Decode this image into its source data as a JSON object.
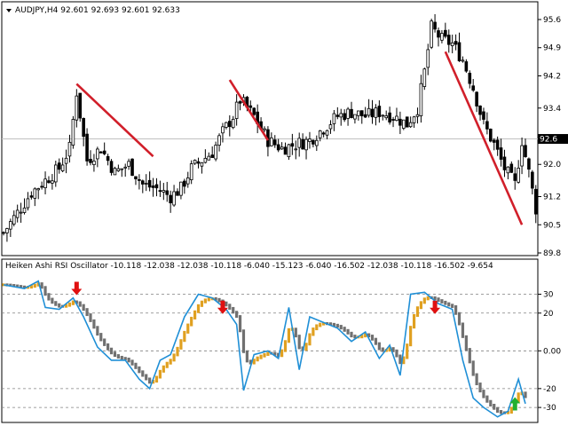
{
  "main_panel": {
    "title": "AUDJPY,H4  92.601 92.693 92.601 92.633",
    "price_labels": [
      "95.6",
      "94.9",
      "94.2",
      "93.4",
      "92.6",
      "92.0",
      "91.2",
      "90.5",
      "89.8"
    ],
    "current_price_label": "92.6",
    "current_price": 92.633,
    "colors": {
      "bull": "#000000",
      "bear": "#000000",
      "trendline": "#d11f2a",
      "current_line": "#c0c0c0"
    }
  },
  "indicator_panel": {
    "title": "Heiken Ashi RSI Oscillator -10.118 -12.038 -12.038 -10.118 -6.040 -15.123 -6.040 -16.502 -12.038 -10.118 -16.502 -9.654",
    "level_labels": [
      "30",
      "20",
      "0.00",
      "-20",
      "-30"
    ],
    "colors": {
      "rsi_line": "#1f8fd6",
      "bull_bar": "#e0a020",
      "bear_bar": "#707070",
      "sell_arrow": "#e01010",
      "buy_arrow": "#20b030",
      "level_line": "#808080"
    }
  },
  "chart_data": [
    {
      "type": "candlestick",
      "title": "AUDJPY,H4  92.601 92.693 92.601 92.633",
      "ylim": [
        89.8,
        95.6
      ],
      "y_ticks": [
        95.6,
        94.9,
        94.2,
        93.4,
        92.6,
        92.0,
        91.2,
        90.5,
        89.8
      ],
      "close_path": [
        [
          0,
          90.3
        ],
        [
          4,
          90.8
        ],
        [
          8,
          91.3
        ],
        [
          12,
          91.6
        ],
        [
          16,
          91.9
        ],
        [
          19,
          92.4
        ],
        [
          21,
          93.8
        ],
        [
          24,
          92.1
        ],
        [
          28,
          92.4
        ],
        [
          32,
          91.8
        ],
        [
          36,
          92.0
        ],
        [
          40,
          91.5
        ],
        [
          44,
          91.4
        ],
        [
          48,
          91.2
        ],
        [
          51,
          91.4
        ],
        [
          54,
          91.9
        ],
        [
          57,
          92.1
        ],
        [
          60,
          92.3
        ],
        [
          63,
          92.8
        ],
        [
          66,
          93.2
        ],
        [
          68,
          93.6
        ],
        [
          72,
          93.2
        ],
        [
          76,
          92.6
        ],
        [
          80,
          92.4
        ],
        [
          84,
          92.5
        ],
        [
          88,
          92.6
        ],
        [
          92,
          92.9
        ],
        [
          96,
          93.2
        ],
        [
          100,
          93.3
        ],
        [
          104,
          93.2
        ],
        [
          108,
          93.3
        ],
        [
          112,
          93.2
        ],
        [
          116,
          93.0
        ],
        [
          119,
          93.4
        ],
        [
          121,
          94.3
        ],
        [
          123,
          95.4
        ],
        [
          126,
          95.1
        ],
        [
          129,
          95.0
        ],
        [
          132,
          94.6
        ],
        [
          135,
          93.9
        ],
        [
          138,
          93.0
        ],
        [
          141,
          92.5
        ],
        [
          144,
          91.9
        ],
        [
          147,
          91.5
        ],
        [
          149,
          92.6
        ],
        [
          151,
          91.8
        ],
        [
          153,
          90.9
        ]
      ],
      "trendlines": [
        {
          "from": [
            21,
            94.0
          ],
          "to": [
            43,
            92.2
          ]
        },
        {
          "from": [
            65,
            94.1
          ],
          "to": [
            76,
            92.6
          ]
        },
        {
          "from": [
            127,
            94.8
          ],
          "to": [
            149,
            90.5
          ]
        }
      ]
    },
    {
      "type": "line",
      "title": "Heiken Ashi RSI Oscillator",
      "ylim": [
        -37,
        42
      ],
      "levels": [
        30,
        20,
        0,
        -20,
        -30
      ],
      "series": [
        {
          "values": [
            [
              0,
              35
            ],
            [
              6,
              33
            ],
            [
              10,
              37
            ],
            [
              12,
              23
            ],
            [
              16,
              22
            ],
            [
              20,
              28
            ],
            [
              23,
              18
            ],
            [
              27,
              2
            ],
            [
              31,
              -5
            ],
            [
              35,
              -5
            ],
            [
              39,
              -15
            ],
            [
              42,
              -20
            ],
            [
              45,
              -5
            ],
            [
              48,
              -2
            ],
            [
              52,
              18
            ],
            [
              56,
              30
            ],
            [
              60,
              28
            ],
            [
              64,
              22
            ],
            [
              67,
              14
            ],
            [
              69,
              -21
            ],
            [
              72,
              -2
            ],
            [
              76,
              0
            ],
            [
              79,
              -4
            ],
            [
              82,
              23
            ],
            [
              85,
              -10
            ],
            [
              88,
              18
            ],
            [
              92,
              15
            ],
            [
              96,
              12
            ],
            [
              100,
              5
            ],
            [
              104,
              10
            ],
            [
              108,
              -4
            ],
            [
              111,
              3
            ],
            [
              114,
              -13
            ],
            [
              117,
              30
            ],
            [
              121,
              31
            ],
            [
              125,
              25
            ],
            [
              129,
              22
            ],
            [
              132,
              -5
            ],
            [
              135,
              -25
            ],
            [
              138,
              -30
            ],
            [
              142,
              -35
            ],
            [
              145,
              -32
            ],
            [
              148,
              -15
            ],
            [
              150,
              -28
            ]
          ]
        }
      ],
      "annotations": {
        "sell_arrows": [
          [
            21,
            30
          ],
          [
            63,
            20
          ],
          [
            124,
            20
          ]
        ],
        "buy_arrows": [
          [
            147,
            -25
          ]
        ]
      }
    }
  ]
}
